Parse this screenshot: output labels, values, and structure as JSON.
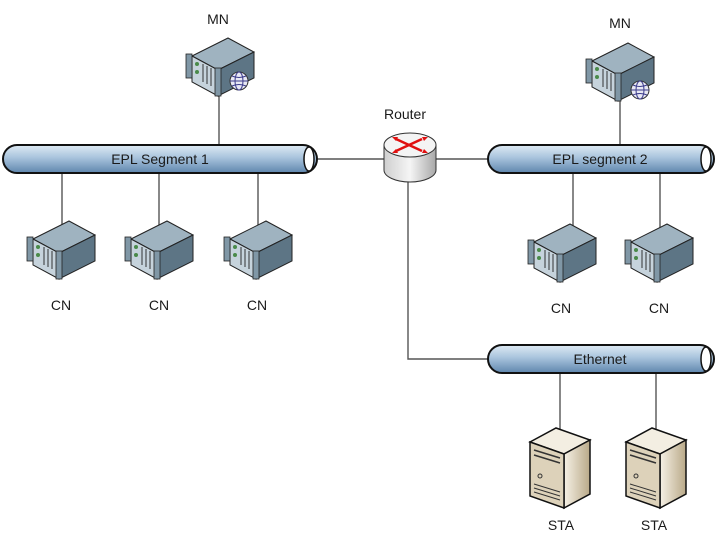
{
  "diagram": {
    "buses": [
      {
        "label": "EPL Segment 1"
      },
      {
        "label": "EPL segment 2"
      },
      {
        "label": "Ethernet"
      }
    ],
    "router": {
      "label": "Router",
      "icon": "router-icon"
    },
    "managing_nodes": [
      {
        "label": "MN"
      },
      {
        "label": "MN"
      }
    ],
    "controlled_nodes": [
      {
        "label": "CN"
      },
      {
        "label": "CN"
      },
      {
        "label": "CN"
      },
      {
        "label": "CN"
      },
      {
        "label": "CN"
      }
    ],
    "stations": [
      {
        "label": "STA"
      },
      {
        "label": "STA"
      }
    ],
    "colors": {
      "bus_fill": "#a9c4dd",
      "router_arrows": "#e01010",
      "station_fill": "#e6dcc6",
      "server_fill": "#7f96a6"
    }
  }
}
